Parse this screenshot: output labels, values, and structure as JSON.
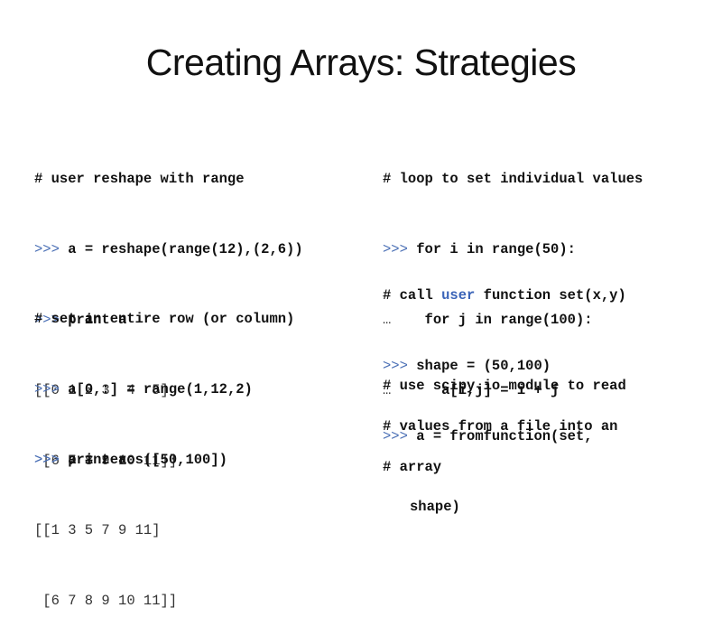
{
  "slide": {
    "title": "Creating Arrays: Strategies",
    "prompt": ">>>",
    "continuation": "…",
    "left": {
      "block1": {
        "comment": "# user reshape with range",
        "cmd1": "a = reshape(range(12),(2,6))",
        "cmd2": "print a",
        "out1": "[[0 1 2 3  4  5]",
        "out2": " [6 7 8 9 10 11]]"
      },
      "block2": {
        "comment": "# set an entire row (or column)",
        "cmd1": "a[0,:] = range(1,12,2)",
        "cmd2": "print a",
        "out1": "[[1 3 5 7 9 11]",
        "out2": " [6 7 8 9 10 11]]"
      },
      "block3": {
        "cmd1": "a = zeros([50,100])"
      }
    },
    "right": {
      "block1": {
        "comment": "# loop to set individual values",
        "cmd1": "for i in range(50):",
        "cont1": "   for j in range(100):",
        "cont2": "     a[i,j] = i + j"
      },
      "block2": {
        "comment_pre": "# call ",
        "comment_hl": "user",
        "comment_post": " function set(x,y)",
        "cmd1": "shape = (50,100)",
        "cmd2": "a = fromfunction(set,",
        "cmd2_cont": "shape)"
      },
      "block3": {
        "line1": "# use scipy.io module to read",
        "line2": "# values from a file into an",
        "line3": "# array"
      }
    }
  }
}
